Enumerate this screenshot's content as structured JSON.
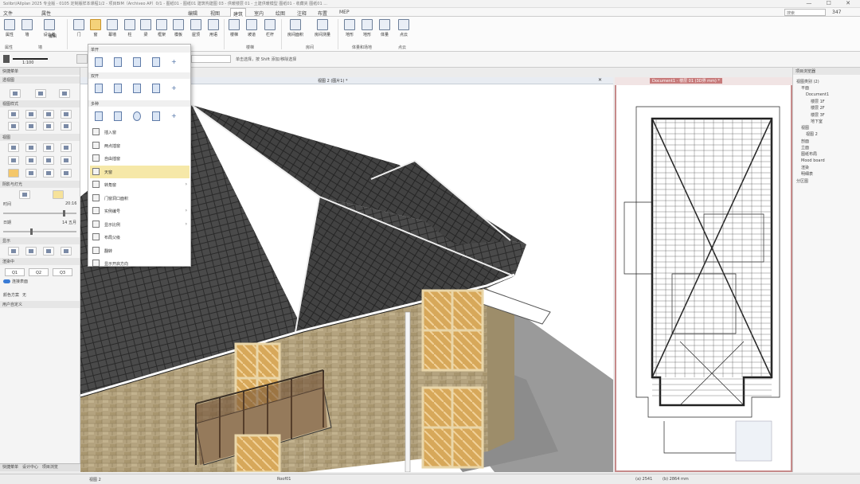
{
  "window": {
    "title": "Solibri/Allplan 2025 专业版 - 0105 定制版样本课程1/2 - 项目BIM（Archiveo AP）0/1 - 图纸01 - 图纸01 建筑构建图 03 - 供暖楼层 01 - 土建供暖模型 图纸01 - 收藏夹 图纸01 ...",
    "controls": [
      "—",
      "☐",
      "✕"
    ]
  },
  "menubar": {
    "items": [
      "文件",
      "属性",
      "编辑",
      "视图",
      "建筑",
      "室内",
      "绘图",
      "注释",
      "布置",
      "MEP"
    ],
    "active": "建筑",
    "search_placeholder": "搜索",
    "user": "347"
  },
  "ribbon": {
    "buttons": [
      {
        "label": "属性"
      },
      {
        "label": "墙"
      },
      {
        "label": "设计者"
      },
      {
        "label": "编辑"
      },
      {
        "label": "门"
      },
      {
        "label": "窗"
      },
      {
        "label": "幕墙"
      },
      {
        "label": "柱"
      },
      {
        "label": "梁"
      },
      {
        "label": "框架"
      },
      {
        "label": "模板"
      },
      {
        "label": "屋顶"
      },
      {
        "label": "用语"
      },
      {
        "label": "楼梯"
      },
      {
        "label": "坡道"
      },
      {
        "label": "栏杆"
      },
      {
        "label": "房间面积"
      },
      {
        "label": "房间测量"
      },
      {
        "label": "地形"
      },
      {
        "label": "地形"
      },
      {
        "label": "体量"
      },
      {
        "label": "点云"
      }
    ],
    "groups": [
      "属性",
      "墙",
      "楼梯",
      "房间",
      "体量和场地",
      "点云"
    ]
  },
  "optbar": {
    "scale": "1:100",
    "hint": "单击选择，按 Shift 添加/移除选择"
  },
  "leftpanel": {
    "title": "快捷菜单",
    "sections": [
      "透视图",
      "视图样式",
      "视图",
      "阴影与灯光",
      "显示",
      "渲染中",
      "颜色方案"
    ],
    "time_label": "时间",
    "time_value": "20:16",
    "date_label": "日期",
    "date_value": "14 五月",
    "render_options": [
      "Q1",
      "Q2",
      "Q3"
    ],
    "connect_label": "连接表面",
    "color_scheme_value": "无",
    "user_defined": "用户自定义",
    "bottom_tabs": [
      "快捷菜单",
      "设计中心",
      "项目浏览"
    ]
  },
  "dropdown": {
    "sections": [
      "单开",
      "双开",
      "多种"
    ],
    "items": [
      {
        "label": "插入窗",
        "has_sub": false
      },
      {
        "label": "两点插窗",
        "has_sub": false
      },
      {
        "label": "自由插窗",
        "has_sub": false
      },
      {
        "label": "天窗",
        "has_sub": false
      },
      {
        "label": "转角窗",
        "has_sub": true
      },
      {
        "label": "门窗洞口面积",
        "has_sub": false
      },
      {
        "label": "实例编号",
        "has_sub": true
      },
      {
        "label": "显示比例",
        "has_sub": true
      },
      {
        "label": "布局父级",
        "has_sub": false
      },
      {
        "label": "翻转",
        "has_sub": false
      },
      {
        "label": "显示开启方向",
        "has_sub": false
      }
    ],
    "highlighted": "天窗"
  },
  "viewport": {
    "tab_label": "视图 2 (图片1) *"
  },
  "planpane": {
    "tab_label": "Document1 - 楼层 01 (3D界 mm) *"
  },
  "rightpanel": {
    "title": "项目浏览器",
    "tree": [
      {
        "label": "视图类别 (2)",
        "level": 0
      },
      {
        "label": "平面",
        "level": 1
      },
      {
        "label": "Document1",
        "level": 2
      },
      {
        "label": "楼层 1F",
        "level": 3
      },
      {
        "label": "楼层 2F",
        "level": 3
      },
      {
        "label": "楼层 3F",
        "level": 3
      },
      {
        "label": "地下室",
        "level": 3
      },
      {
        "label": "视图",
        "level": 1
      },
      {
        "label": "视图 2",
        "level": 2
      },
      {
        "label": "剖面",
        "level": 1
      },
      {
        "label": "立面",
        "level": 1
      },
      {
        "label": "图纸布局",
        "level": 1
      },
      {
        "label": "Mood board",
        "level": 1
      },
      {
        "label": "渲染",
        "level": 1
      },
      {
        "label": "明细表",
        "level": 1
      },
      {
        "label": "分区图",
        "level": 0
      }
    ]
  },
  "statusbar": {
    "view": "视图 2",
    "layer": "Roof01",
    "coord_x": "(a) 2541",
    "coord_y": "(b) 2864 mm"
  },
  "colors": {
    "accent": "#c68a8a",
    "highlight": "#f6e8a8",
    "roof": "#3f3f3f",
    "wall": "#b3a27f"
  }
}
